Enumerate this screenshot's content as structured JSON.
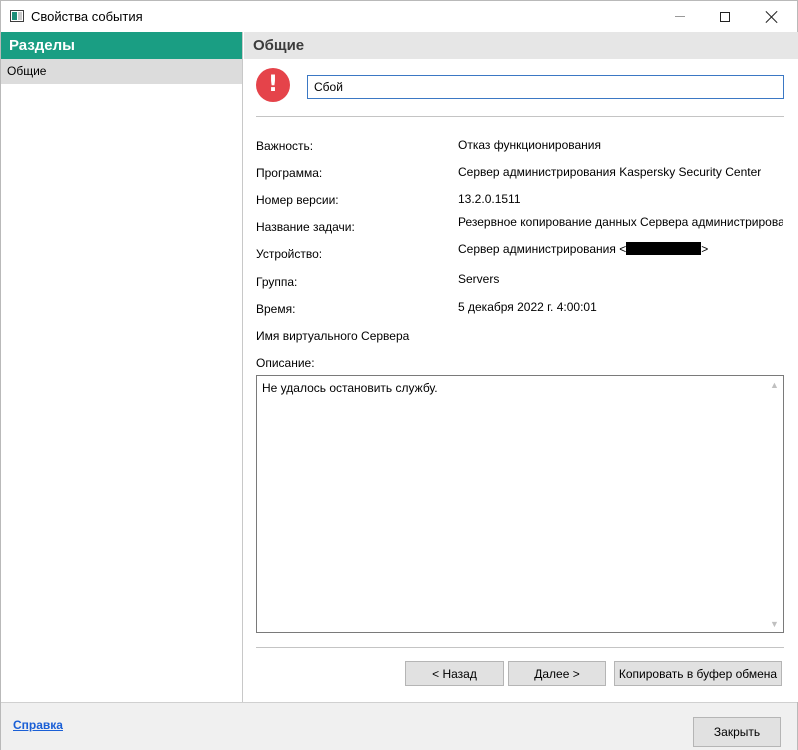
{
  "window": {
    "title": "Свойства события"
  },
  "sidebar": {
    "header": "Разделы",
    "items": [
      {
        "label": "Общие",
        "selected": true
      }
    ]
  },
  "main": {
    "header": "Общие",
    "event_name": "Сбой",
    "severity_icon": "error-exclamation-icon",
    "properties": [
      {
        "label": "Важность:",
        "value": "Отказ функционирования"
      },
      {
        "label": "Программа:",
        "value": "Сервер администрирования Kaspersky Security Center"
      },
      {
        "label": "Номер версии:",
        "value": "13.2.0.1511"
      },
      {
        "label": "Название задачи:",
        "value": "Резервное копирование данных Сервера администрировани"
      },
      {
        "label": "Устройство:",
        "value_prefix": "Сервер администрирования <",
        "value_suffix": ">"
      },
      {
        "label": "Группа:",
        "value": "Servers"
      },
      {
        "label": "Время:",
        "value": "5 декабря 2022 г. 4:00:01"
      },
      {
        "label": "Имя виртуального Сервера",
        "value": ""
      }
    ],
    "description_label": "Описание:",
    "description_text": "Не удалось остановить службу.",
    "buttons": {
      "back": "< Назад",
      "next": "Далее >",
      "copy": "Копировать в буфер обмена"
    }
  },
  "footer": {
    "help_link": "Справка",
    "close_button": "Закрыть"
  },
  "colors": {
    "accent": "#1a9e83",
    "error": "#e5434a",
    "link": "#1a5fd6"
  }
}
